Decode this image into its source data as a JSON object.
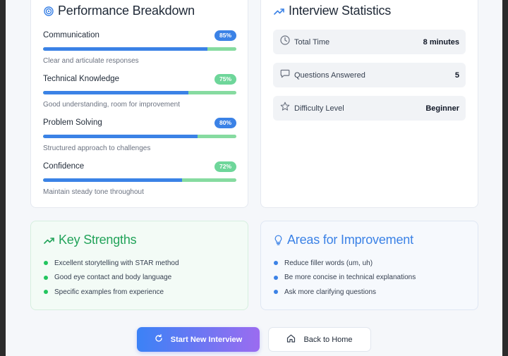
{
  "performance": {
    "title": "Performance Breakdown",
    "icon": "target-icon",
    "metrics": [
      {
        "name": "Communication",
        "score": "85%",
        "fill": 0.85,
        "description": "Clear and articulate responses",
        "badge_color": "#3b82e6"
      },
      {
        "name": "Technical Knowledge",
        "score": "75%",
        "fill": 0.75,
        "description": "Good understanding, room for improvement",
        "badge_color": "#6ed69a"
      },
      {
        "name": "Problem Solving",
        "score": "80%",
        "fill": 0.8,
        "description": "Structured approach to challenges",
        "badge_color": "#3b82e6"
      },
      {
        "name": "Confidence",
        "score": "72%",
        "fill": 0.72,
        "description": "Maintain steady tone throughout",
        "badge_color": "#6ed69a"
      }
    ]
  },
  "statistics": {
    "title": "Interview Statistics",
    "icon": "trending-up-icon",
    "rows": [
      {
        "label": "Total Time",
        "value": "8 minutes",
        "icon": "clock-icon"
      },
      {
        "label": "Questions Answered",
        "value": "5",
        "icon": "message-square-icon"
      },
      {
        "label": "Difficulty Level",
        "value": "Beginner",
        "icon": "star-icon"
      }
    ]
  },
  "strengths": {
    "title": "Key Strengths",
    "icon": "trending-up-icon",
    "color": "#22a35a",
    "items": [
      "Excellent storytelling with STAR method",
      "Good eye contact and body language",
      "Specific examples from experience"
    ]
  },
  "improvements": {
    "title": "Areas for Improvement",
    "icon": "lightbulb-icon",
    "color": "#3b82e6",
    "items": [
      "Reduce filler words (um, uh)",
      "Be more concise in technical explanations",
      "Ask more clarifying questions"
    ]
  },
  "actions": {
    "start_label": "Start New Interview",
    "home_label": "Back to Home"
  }
}
